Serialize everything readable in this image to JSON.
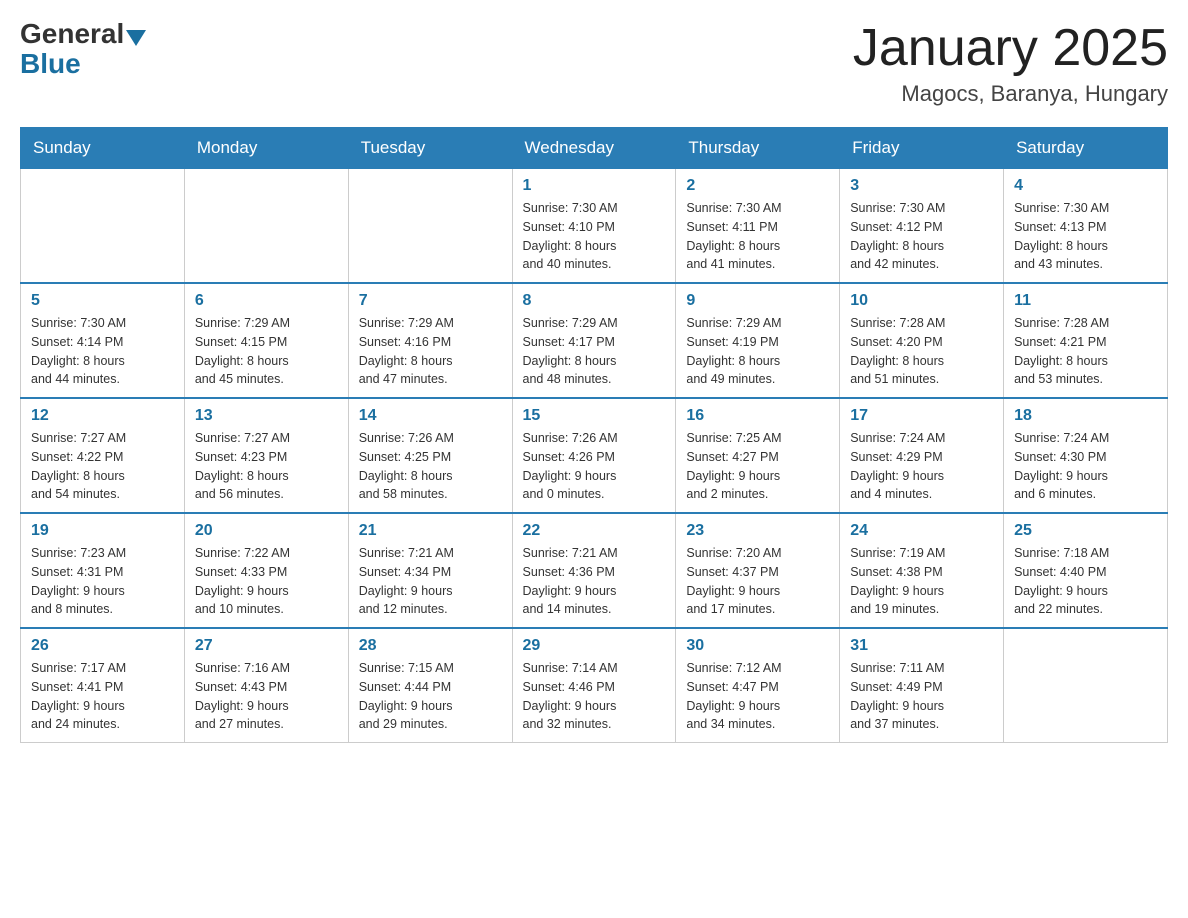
{
  "header": {
    "logo_general": "General",
    "logo_blue": "Blue",
    "title": "January 2025",
    "subtitle": "Magocs, Baranya, Hungary"
  },
  "weekdays": [
    "Sunday",
    "Monday",
    "Tuesday",
    "Wednesday",
    "Thursday",
    "Friday",
    "Saturday"
  ],
  "weeks": [
    [
      {
        "day": "",
        "info": ""
      },
      {
        "day": "",
        "info": ""
      },
      {
        "day": "",
        "info": ""
      },
      {
        "day": "1",
        "info": "Sunrise: 7:30 AM\nSunset: 4:10 PM\nDaylight: 8 hours\nand 40 minutes."
      },
      {
        "day": "2",
        "info": "Sunrise: 7:30 AM\nSunset: 4:11 PM\nDaylight: 8 hours\nand 41 minutes."
      },
      {
        "day": "3",
        "info": "Sunrise: 7:30 AM\nSunset: 4:12 PM\nDaylight: 8 hours\nand 42 minutes."
      },
      {
        "day": "4",
        "info": "Sunrise: 7:30 AM\nSunset: 4:13 PM\nDaylight: 8 hours\nand 43 minutes."
      }
    ],
    [
      {
        "day": "5",
        "info": "Sunrise: 7:30 AM\nSunset: 4:14 PM\nDaylight: 8 hours\nand 44 minutes."
      },
      {
        "day": "6",
        "info": "Sunrise: 7:29 AM\nSunset: 4:15 PM\nDaylight: 8 hours\nand 45 minutes."
      },
      {
        "day": "7",
        "info": "Sunrise: 7:29 AM\nSunset: 4:16 PM\nDaylight: 8 hours\nand 47 minutes."
      },
      {
        "day": "8",
        "info": "Sunrise: 7:29 AM\nSunset: 4:17 PM\nDaylight: 8 hours\nand 48 minutes."
      },
      {
        "day": "9",
        "info": "Sunrise: 7:29 AM\nSunset: 4:19 PM\nDaylight: 8 hours\nand 49 minutes."
      },
      {
        "day": "10",
        "info": "Sunrise: 7:28 AM\nSunset: 4:20 PM\nDaylight: 8 hours\nand 51 minutes."
      },
      {
        "day": "11",
        "info": "Sunrise: 7:28 AM\nSunset: 4:21 PM\nDaylight: 8 hours\nand 53 minutes."
      }
    ],
    [
      {
        "day": "12",
        "info": "Sunrise: 7:27 AM\nSunset: 4:22 PM\nDaylight: 8 hours\nand 54 minutes."
      },
      {
        "day": "13",
        "info": "Sunrise: 7:27 AM\nSunset: 4:23 PM\nDaylight: 8 hours\nand 56 minutes."
      },
      {
        "day": "14",
        "info": "Sunrise: 7:26 AM\nSunset: 4:25 PM\nDaylight: 8 hours\nand 58 minutes."
      },
      {
        "day": "15",
        "info": "Sunrise: 7:26 AM\nSunset: 4:26 PM\nDaylight: 9 hours\nand 0 minutes."
      },
      {
        "day": "16",
        "info": "Sunrise: 7:25 AM\nSunset: 4:27 PM\nDaylight: 9 hours\nand 2 minutes."
      },
      {
        "day": "17",
        "info": "Sunrise: 7:24 AM\nSunset: 4:29 PM\nDaylight: 9 hours\nand 4 minutes."
      },
      {
        "day": "18",
        "info": "Sunrise: 7:24 AM\nSunset: 4:30 PM\nDaylight: 9 hours\nand 6 minutes."
      }
    ],
    [
      {
        "day": "19",
        "info": "Sunrise: 7:23 AM\nSunset: 4:31 PM\nDaylight: 9 hours\nand 8 minutes."
      },
      {
        "day": "20",
        "info": "Sunrise: 7:22 AM\nSunset: 4:33 PM\nDaylight: 9 hours\nand 10 minutes."
      },
      {
        "day": "21",
        "info": "Sunrise: 7:21 AM\nSunset: 4:34 PM\nDaylight: 9 hours\nand 12 minutes."
      },
      {
        "day": "22",
        "info": "Sunrise: 7:21 AM\nSunset: 4:36 PM\nDaylight: 9 hours\nand 14 minutes."
      },
      {
        "day": "23",
        "info": "Sunrise: 7:20 AM\nSunset: 4:37 PM\nDaylight: 9 hours\nand 17 minutes."
      },
      {
        "day": "24",
        "info": "Sunrise: 7:19 AM\nSunset: 4:38 PM\nDaylight: 9 hours\nand 19 minutes."
      },
      {
        "day": "25",
        "info": "Sunrise: 7:18 AM\nSunset: 4:40 PM\nDaylight: 9 hours\nand 22 minutes."
      }
    ],
    [
      {
        "day": "26",
        "info": "Sunrise: 7:17 AM\nSunset: 4:41 PM\nDaylight: 9 hours\nand 24 minutes."
      },
      {
        "day": "27",
        "info": "Sunrise: 7:16 AM\nSunset: 4:43 PM\nDaylight: 9 hours\nand 27 minutes."
      },
      {
        "day": "28",
        "info": "Sunrise: 7:15 AM\nSunset: 4:44 PM\nDaylight: 9 hours\nand 29 minutes."
      },
      {
        "day": "29",
        "info": "Sunrise: 7:14 AM\nSunset: 4:46 PM\nDaylight: 9 hours\nand 32 minutes."
      },
      {
        "day": "30",
        "info": "Sunrise: 7:12 AM\nSunset: 4:47 PM\nDaylight: 9 hours\nand 34 minutes."
      },
      {
        "day": "31",
        "info": "Sunrise: 7:11 AM\nSunset: 4:49 PM\nDaylight: 9 hours\nand 37 minutes."
      },
      {
        "day": "",
        "info": ""
      }
    ]
  ]
}
